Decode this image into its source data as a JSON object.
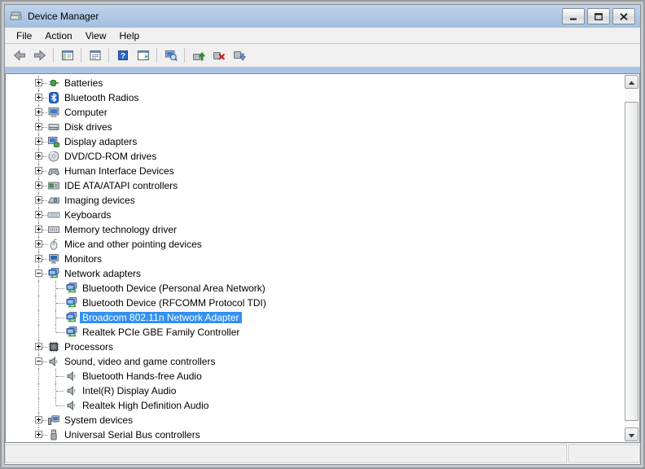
{
  "window": {
    "title": "Device Manager"
  },
  "menu": {
    "items": [
      {
        "label": "File"
      },
      {
        "label": "Action"
      },
      {
        "label": "View"
      },
      {
        "label": "Help"
      }
    ]
  },
  "toolbar": {
    "buttons": [
      {
        "type": "button",
        "icon": "back-icon"
      },
      {
        "type": "button",
        "icon": "forward-icon"
      },
      {
        "type": "separator"
      },
      {
        "type": "button",
        "icon": "console-tree-icon"
      },
      {
        "type": "separator"
      },
      {
        "type": "button",
        "icon": "properties-icon"
      },
      {
        "type": "separator"
      },
      {
        "type": "button",
        "icon": "help-icon"
      },
      {
        "type": "button",
        "icon": "action-pane-icon"
      },
      {
        "type": "separator"
      },
      {
        "type": "button",
        "icon": "scan-hardware-icon"
      },
      {
        "type": "separator"
      },
      {
        "type": "button",
        "icon": "update-driver-icon"
      },
      {
        "type": "button",
        "icon": "uninstall-device-icon"
      },
      {
        "type": "button",
        "icon": "disable-device-icon"
      }
    ]
  },
  "tree": {
    "items": [
      {
        "label": "Batteries",
        "level": 0,
        "state": "collapsed",
        "icon": "battery-icon",
        "selected": false
      },
      {
        "label": "Bluetooth Radios",
        "level": 0,
        "state": "collapsed",
        "icon": "bluetooth-icon",
        "selected": false
      },
      {
        "label": "Computer",
        "level": 0,
        "state": "collapsed",
        "icon": "computer-icon",
        "selected": false
      },
      {
        "label": "Disk drives",
        "level": 0,
        "state": "collapsed",
        "icon": "disk-drive-icon",
        "selected": false
      },
      {
        "label": "Display adapters",
        "level": 0,
        "state": "collapsed",
        "icon": "display-adapter-icon",
        "selected": false
      },
      {
        "label": "DVD/CD-ROM drives",
        "level": 0,
        "state": "collapsed",
        "icon": "dvd-drive-icon",
        "selected": false
      },
      {
        "label": "Human Interface Devices",
        "level": 0,
        "state": "collapsed",
        "icon": "hid-icon",
        "selected": false
      },
      {
        "label": "IDE ATA/ATAPI controllers",
        "level": 0,
        "state": "collapsed",
        "icon": "ide-controller-icon",
        "selected": false
      },
      {
        "label": "Imaging devices",
        "level": 0,
        "state": "collapsed",
        "icon": "imaging-device-icon",
        "selected": false
      },
      {
        "label": "Keyboards",
        "level": 0,
        "state": "collapsed",
        "icon": "keyboard-icon",
        "selected": false
      },
      {
        "label": "Memory technology driver",
        "level": 0,
        "state": "collapsed",
        "icon": "memory-icon",
        "selected": false
      },
      {
        "label": "Mice and other pointing devices",
        "level": 0,
        "state": "collapsed",
        "icon": "mouse-icon",
        "selected": false
      },
      {
        "label": "Monitors",
        "level": 0,
        "state": "collapsed",
        "icon": "monitor-icon",
        "selected": false
      },
      {
        "label": "Network adapters",
        "level": 0,
        "state": "expanded",
        "icon": "network-adapter-icon",
        "selected": false
      },
      {
        "label": "Bluetooth Device (Personal Area Network)",
        "level": 1,
        "state": "leaf",
        "icon": "network-adapter-icon",
        "selected": false
      },
      {
        "label": "Bluetooth Device (RFCOMM Protocol TDI)",
        "level": 1,
        "state": "leaf",
        "icon": "network-adapter-icon",
        "selected": false
      },
      {
        "label": "Broadcom 802.11n Network Adapter",
        "level": 1,
        "state": "leaf",
        "icon": "network-adapter-icon",
        "selected": true
      },
      {
        "label": "Realtek PCIe GBE Family Controller",
        "level": 1,
        "state": "leaf",
        "icon": "network-adapter-icon",
        "selected": false
      },
      {
        "label": "Processors",
        "level": 0,
        "state": "collapsed",
        "icon": "processor-icon",
        "selected": false
      },
      {
        "label": "Sound, video and game controllers",
        "level": 0,
        "state": "expanded",
        "icon": "audio-icon",
        "selected": false
      },
      {
        "label": "Bluetooth Hands-free Audio",
        "level": 1,
        "state": "leaf",
        "icon": "audio-icon",
        "selected": false
      },
      {
        "label": "Intel(R) Display Audio",
        "level": 1,
        "state": "leaf",
        "icon": "audio-icon",
        "selected": false
      },
      {
        "label": "Realtek High Definition Audio",
        "level": 1,
        "state": "leaf",
        "icon": "audio-icon",
        "selected": false
      },
      {
        "label": "System devices",
        "level": 0,
        "state": "collapsed",
        "icon": "system-device-icon",
        "selected": false
      },
      {
        "label": "Universal Serial Bus controllers",
        "level": 0,
        "state": "collapsed",
        "icon": "usb-icon",
        "selected": false
      }
    ]
  },
  "status_bar": {
    "left": "",
    "right": ""
  },
  "colors": {
    "titlebar_top": "#BED3EC",
    "titlebar_bottom": "#A3BFDF",
    "selection": "#3390F0",
    "accent_strip": "#ABC6E5",
    "panel_border": "#828790",
    "client_bg": "#F0F0F0",
    "window_frame": "#C6C9CB"
  }
}
